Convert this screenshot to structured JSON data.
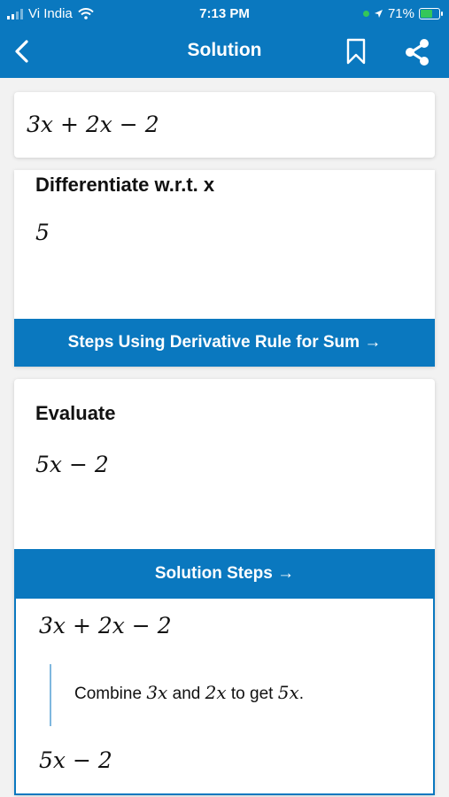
{
  "status_bar": {
    "carrier": "Vi India",
    "time": "7:13 PM",
    "battery_percent": "71%",
    "battery_level": 0.71
  },
  "header": {
    "title": "Solution",
    "back_icon": "chevron-left-icon",
    "bookmark_icon": "bookmark-icon",
    "share_icon": "share-icon"
  },
  "problem": {
    "expression": "3x + 2x − 2"
  },
  "differentiate": {
    "heading": "Differentiate w.r.t. x",
    "result": "5",
    "steps_button": "Steps Using Derivative Rule for Sum →"
  },
  "evaluate": {
    "heading": "Evaluate",
    "result": "5x − 2",
    "steps_button": "Solution Steps →",
    "steps": {
      "start": "3x + 2x − 2",
      "explain_prefix": "Combine ",
      "term_a": "3x",
      "and_text": " and ",
      "term_b": "2x",
      "to_get_text": " to get ",
      "term_c": "5x",
      "period": ".",
      "end": "5x − 2"
    }
  },
  "colors": {
    "accent": "#0a78bf",
    "background": "#f2f2f2",
    "card": "#ffffff"
  }
}
